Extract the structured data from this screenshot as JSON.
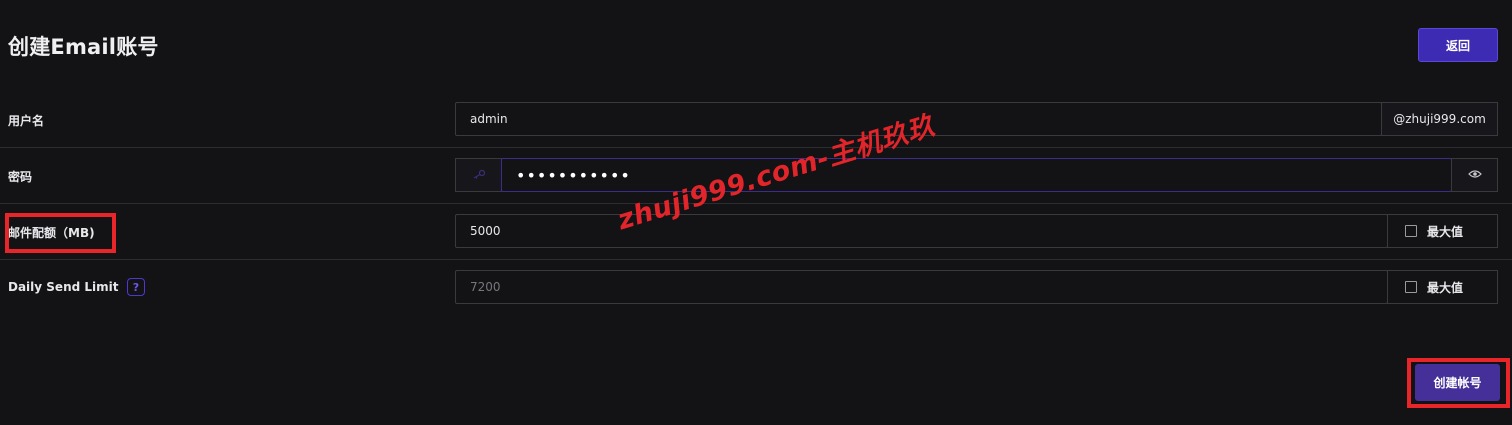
{
  "header": {
    "title": "创建Email账号",
    "back_label": "返回"
  },
  "form": {
    "username": {
      "label": "用户名",
      "value": "admin",
      "domain_suffix": "@zhuji999.com"
    },
    "password": {
      "label": "密码",
      "value": "•••••••••••",
      "leading_icon": "key-icon",
      "toggle_icon": "eye-icon"
    },
    "quota": {
      "label": "邮件配额（MB)",
      "value": "5000",
      "max_label": "最大值",
      "max_checked": false
    },
    "daily_limit": {
      "label": "Daily Send Limit",
      "help_text": "?",
      "placeholder": "7200",
      "max_label": "最大值",
      "max_checked": false
    }
  },
  "actions": {
    "create_label": "创建帐号"
  },
  "watermark": "zhuji999.com-主机玖玖",
  "colors": {
    "background": "#131214",
    "accent": "#3d2bb3",
    "highlight": "#e8262a"
  }
}
